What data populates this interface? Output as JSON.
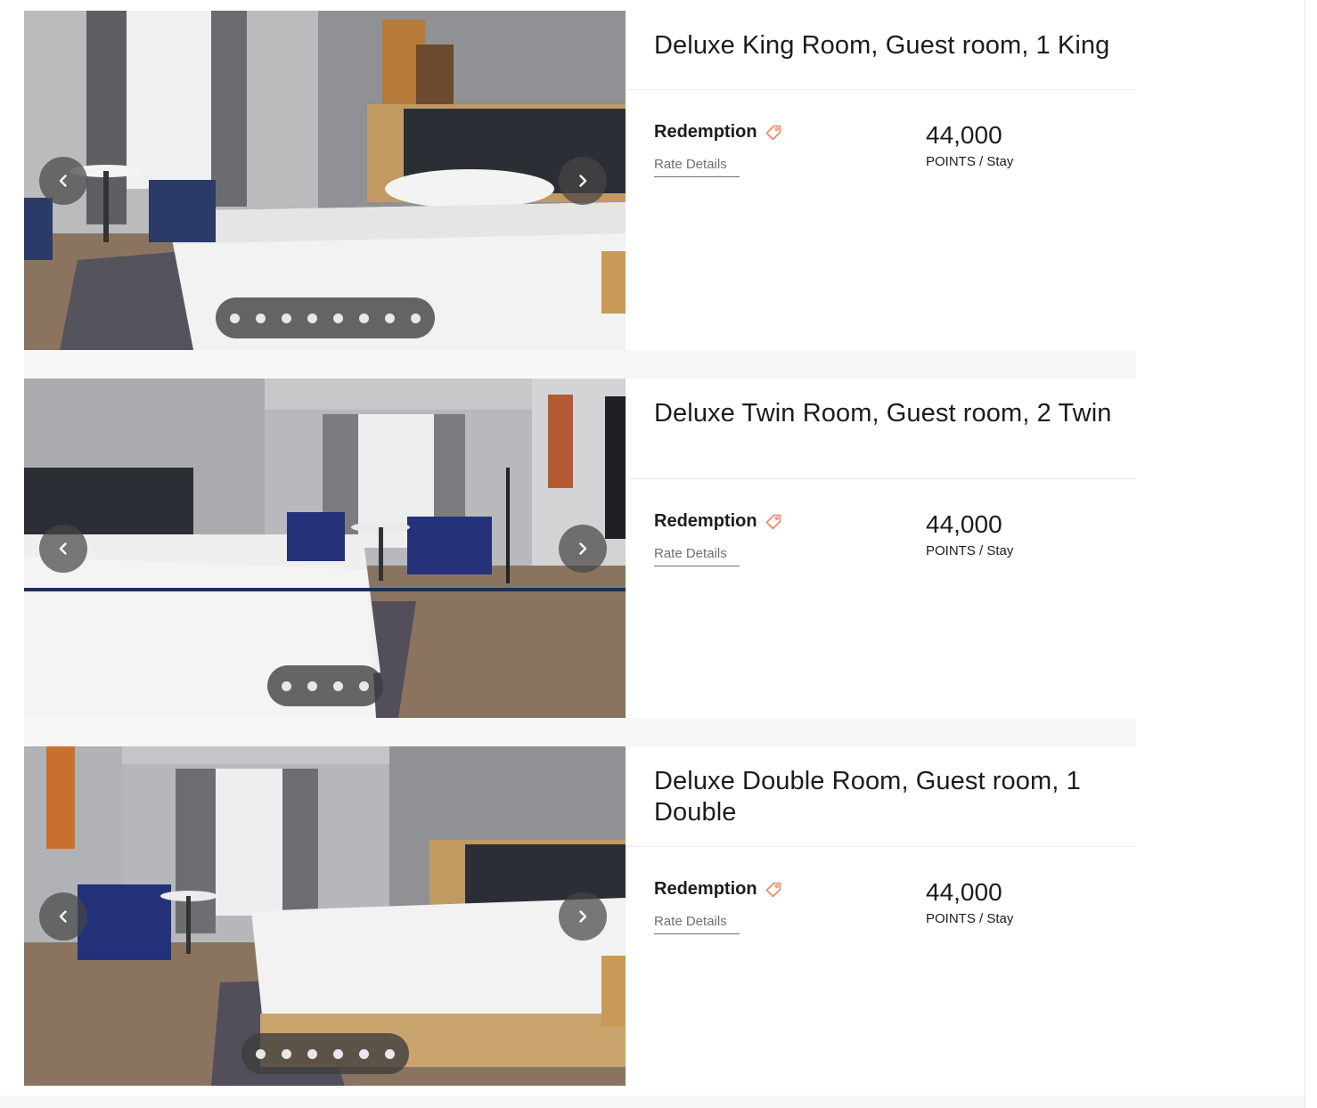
{
  "rooms": [
    {
      "title": "Deluxe King Room, Guest room, 1 King",
      "rate_name": "Redemption",
      "rate_details_label": "Rate Details",
      "points": "44,000",
      "points_label": "POINTS",
      "per_label": "/ Stay",
      "dot_count": 8
    },
    {
      "title": "Deluxe Twin Room, Guest room, 2 Twin",
      "rate_name": "Redemption",
      "rate_details_label": "Rate Details",
      "points": "44,000",
      "points_label": "POINTS",
      "per_label": "/ Stay",
      "dot_count": 4
    },
    {
      "title": "Deluxe Double Room, Guest room, 1 Double",
      "rate_name": "Redemption",
      "rate_details_label": "Rate Details",
      "points": "44,000",
      "points_label": "POINTS",
      "per_label": "/ Stay",
      "dot_count": 6
    }
  ],
  "icons": {
    "prev": "chevron-left-icon",
    "next": "chevron-right-icon",
    "rate_tag": "tag-icon"
  },
  "colors": {
    "accent_tag": "#f4845f",
    "text": "#1c1c1c",
    "muted": "#707070"
  }
}
